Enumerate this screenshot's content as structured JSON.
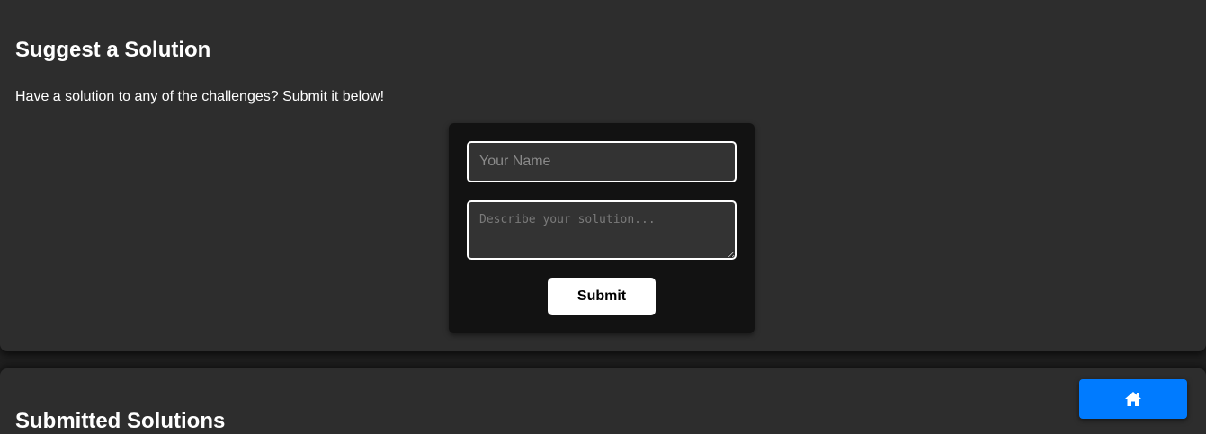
{
  "suggest_section": {
    "title": "Suggest a Solution",
    "intro": "Have a solution to any of the challenges? Submit it below!",
    "form": {
      "name_placeholder": "Your Name",
      "name_value": "",
      "solution_placeholder": "Describe your solution...",
      "solution_value": "",
      "submit_label": "Submit"
    }
  },
  "submitted_section": {
    "title": "Submitted Solutions"
  },
  "home_button": {
    "icon": "home-icon",
    "color": "#007bff"
  },
  "colors": {
    "background": "#2d2d2d",
    "form_background": "#121212",
    "input_background": "#333333",
    "accent": "#007bff"
  }
}
